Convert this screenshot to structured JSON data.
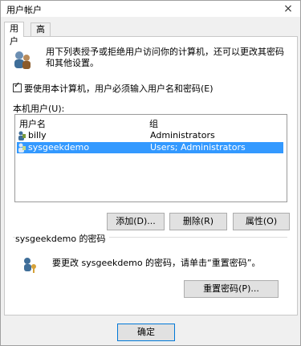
{
  "window": {
    "title": "用户帐户",
    "close_symbol": "×"
  },
  "tabs": [
    {
      "label": "用户"
    },
    {
      "label": "高级"
    }
  ],
  "description": "用下列表授予或拒绝用户访问你的计算机，还可以更改其密码和其他设置。",
  "require_login_checkbox": {
    "label": "要使用本计算机，用户必须输入用户名和密码(E)",
    "checked": true
  },
  "users_label": "本机用户(U):",
  "list": {
    "headers": [
      "用户名",
      "组"
    ],
    "rows": [
      {
        "name": "billy",
        "group": "Administrators",
        "selected": false
      },
      {
        "name": "sysgeekdemo",
        "group": "Users; Administrators",
        "selected": true
      }
    ]
  },
  "buttons": {
    "add": "添加(D)...",
    "remove": "删除(R)",
    "properties": "属性(O)"
  },
  "password_group": {
    "title": "sysgeekdemo 的密码",
    "text": "要更改 sysgeekdemo 的密码，请单击“重置密码”。",
    "reset_button": "重置密码(P)..."
  },
  "footer": {
    "ok_button": "确定"
  }
}
